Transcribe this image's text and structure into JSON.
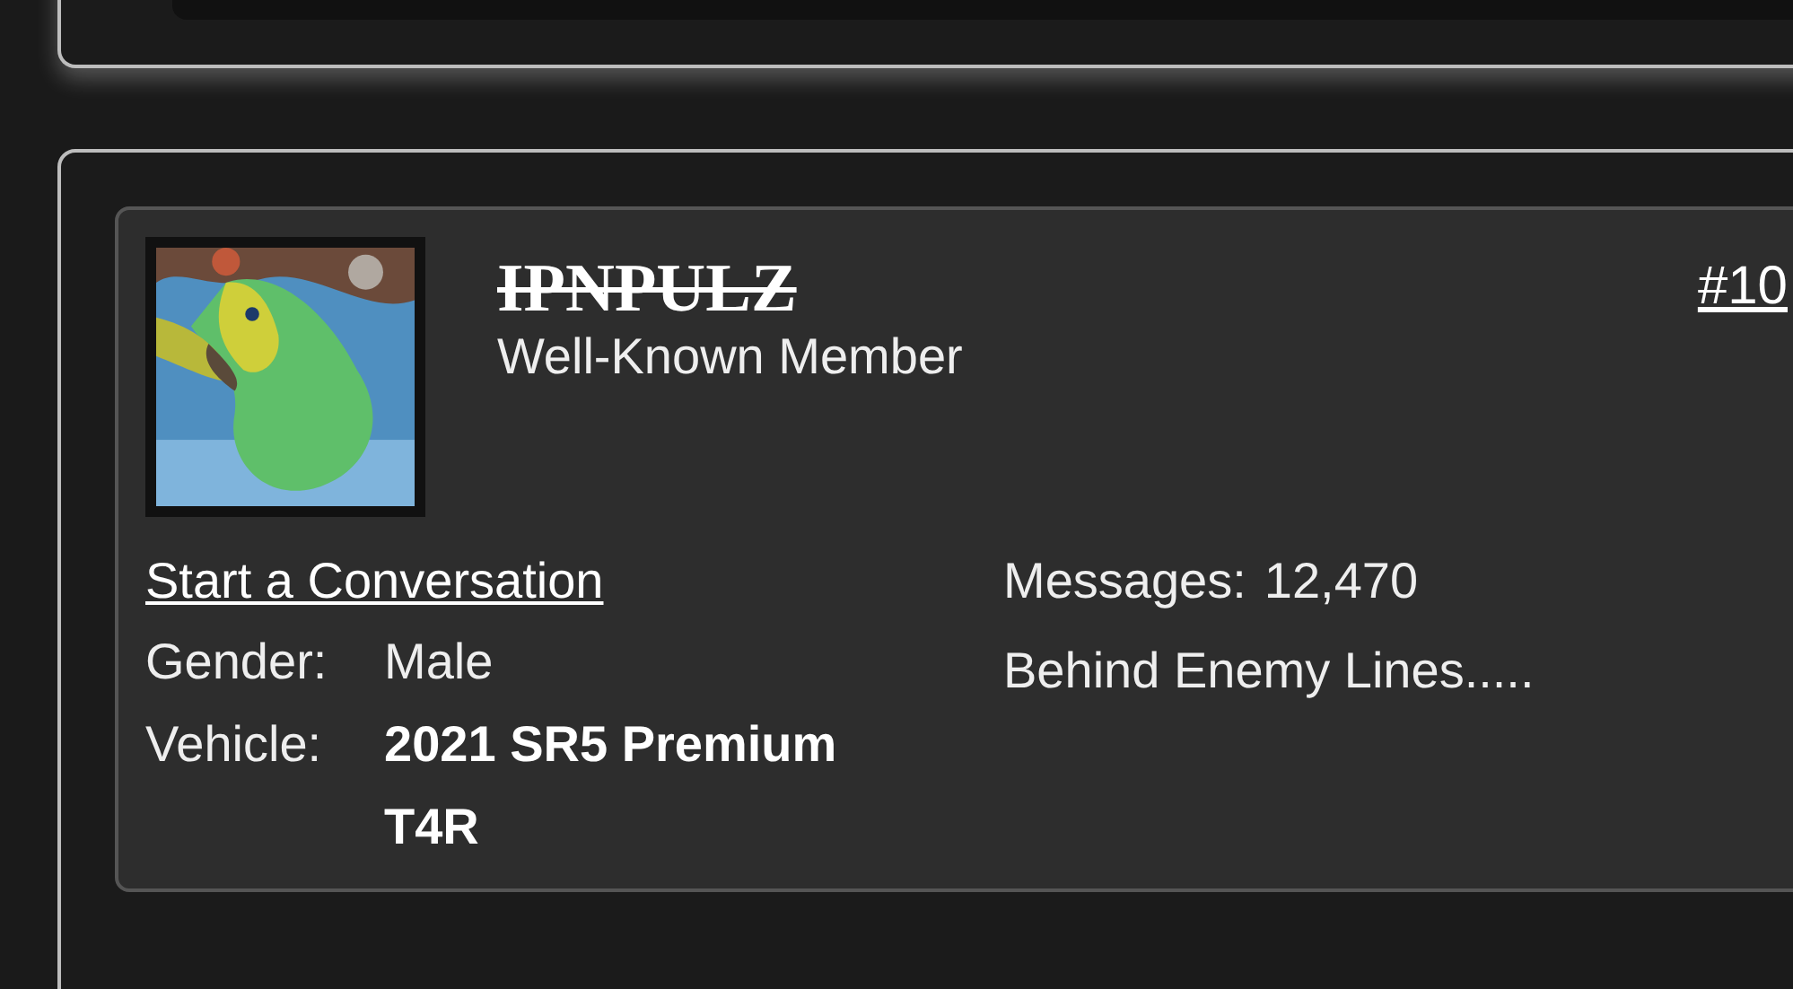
{
  "post": {
    "author": {
      "name": "IPNPULZ",
      "struck": true,
      "title": "Well-Known Member"
    },
    "post_number": "#10",
    "start_conversation": "Start a Conversation",
    "fields": [
      {
        "label": "Gender:",
        "value": "Male",
        "bold": false
      },
      {
        "label": "Vehicle:",
        "value": "2021 SR5 Premium T4R",
        "bold": true
      }
    ],
    "stats": [
      {
        "label": "Messages:",
        "value": "12,470"
      }
    ],
    "location": "Behind Enemy Lines....."
  }
}
